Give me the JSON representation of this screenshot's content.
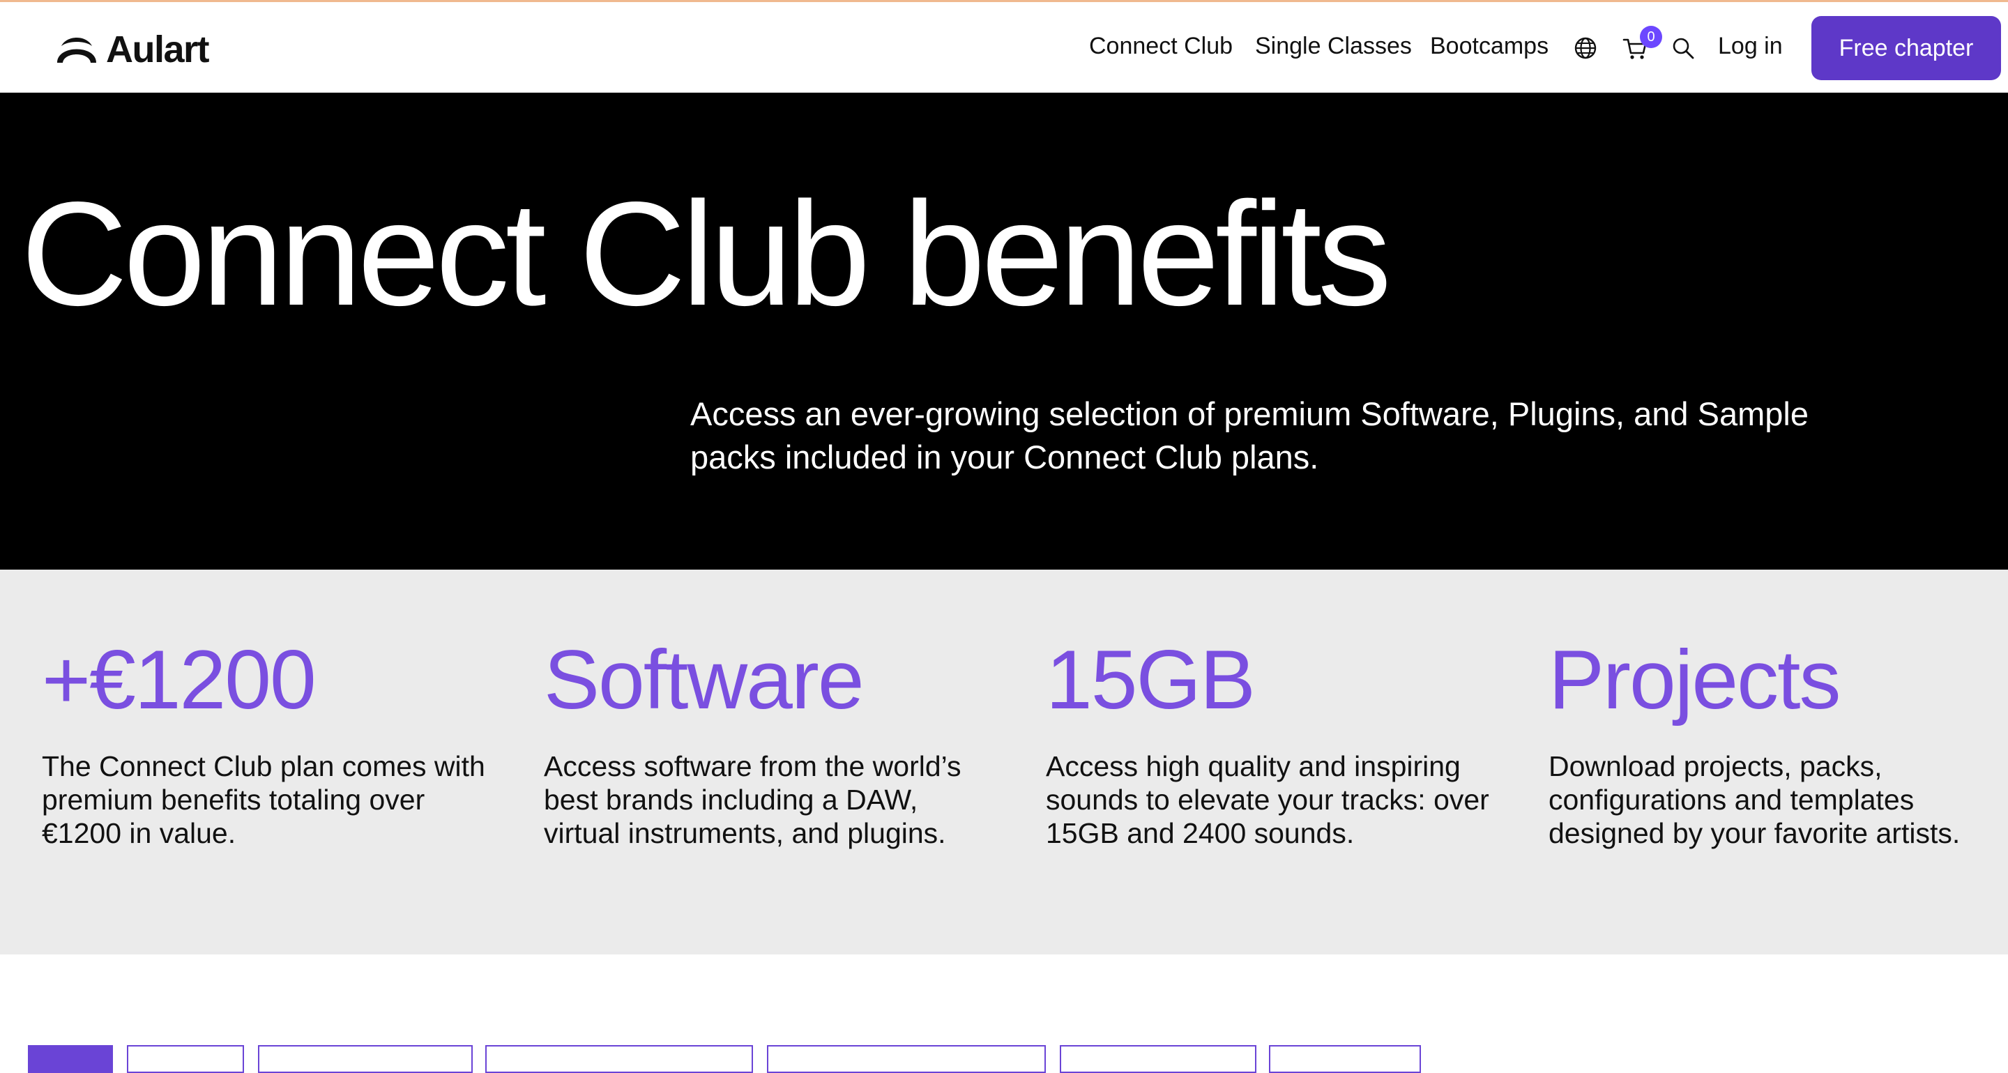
{
  "brand": {
    "name": "Aulart"
  },
  "nav": {
    "links": [
      "Connect Club",
      "Single Classes",
      "Bootcamps"
    ],
    "language_icon": "globe-icon",
    "cart_icon": "cart-icon",
    "cart_count": "0",
    "search_icon": "search-icon",
    "login": "Log in",
    "cta": "Free chapter"
  },
  "hero": {
    "title": "Connect Club benefits",
    "description": "Access an ever-growing selection of premium Software, Plugins, and Sample packs included in your Connect Club plans."
  },
  "benefits": [
    {
      "title": "+€1200",
      "description": "The Connect Club plan comes with premium benefits totaling over €1200 in value."
    },
    {
      "title": "Software",
      "description": "Access software from the world’s best brands including a DAW, virtual instruments, and plugins."
    },
    {
      "title": "15GB",
      "description": "Access high quality and inspiring sounds to elevate your tracks: over 15GB and 2400 sounds."
    },
    {
      "title": "Projects",
      "description": "Download projects, packs, configurations and templates designed by your favorite artists."
    }
  ],
  "colors": {
    "accent": "#6a44d6",
    "cta_background": "#5e38c8",
    "benefit_title": "#7a4fe0",
    "hero_background": "#000000",
    "benefits_background": "#ebebeb"
  }
}
